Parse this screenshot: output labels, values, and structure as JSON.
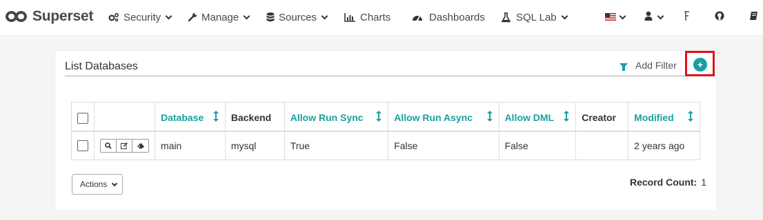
{
  "brand": {
    "name": "Superset"
  },
  "nav": {
    "security": "Security",
    "manage": "Manage",
    "sources": "Sources",
    "charts": "Charts",
    "dashboards": "Dashboards",
    "sql_lab": "SQL Lab"
  },
  "navbar_icons": [
    "us-flag-icon",
    "user-icon",
    "version-icon",
    "github-icon",
    "docs-icon"
  ],
  "panel": {
    "title": "List Databases",
    "add_filter": "Add Filter",
    "add_button_label": "+"
  },
  "table": {
    "columns": [
      {
        "label": "Database",
        "sortable": true
      },
      {
        "label": "Backend",
        "sortable": false
      },
      {
        "label": "Allow Run Sync",
        "sortable": true
      },
      {
        "label": "Allow Run Async",
        "sortable": true
      },
      {
        "label": "Allow DML",
        "sortable": true
      },
      {
        "label": "Creator",
        "sortable": false
      },
      {
        "label": "Modified",
        "sortable": true
      }
    ],
    "rows": [
      {
        "database": "main",
        "backend": "mysql",
        "allow_run_sync": "True",
        "allow_run_async": "False",
        "allow_dml": "False",
        "creator": "",
        "modified": "2 years ago"
      }
    ]
  },
  "footer": {
    "actions_label": "Actions",
    "record_count_label": "Record Count:",
    "record_count": "1"
  },
  "colors": {
    "accent": "#1a9fa0",
    "highlight_frame": "#e0101a",
    "brand": "#484848"
  }
}
